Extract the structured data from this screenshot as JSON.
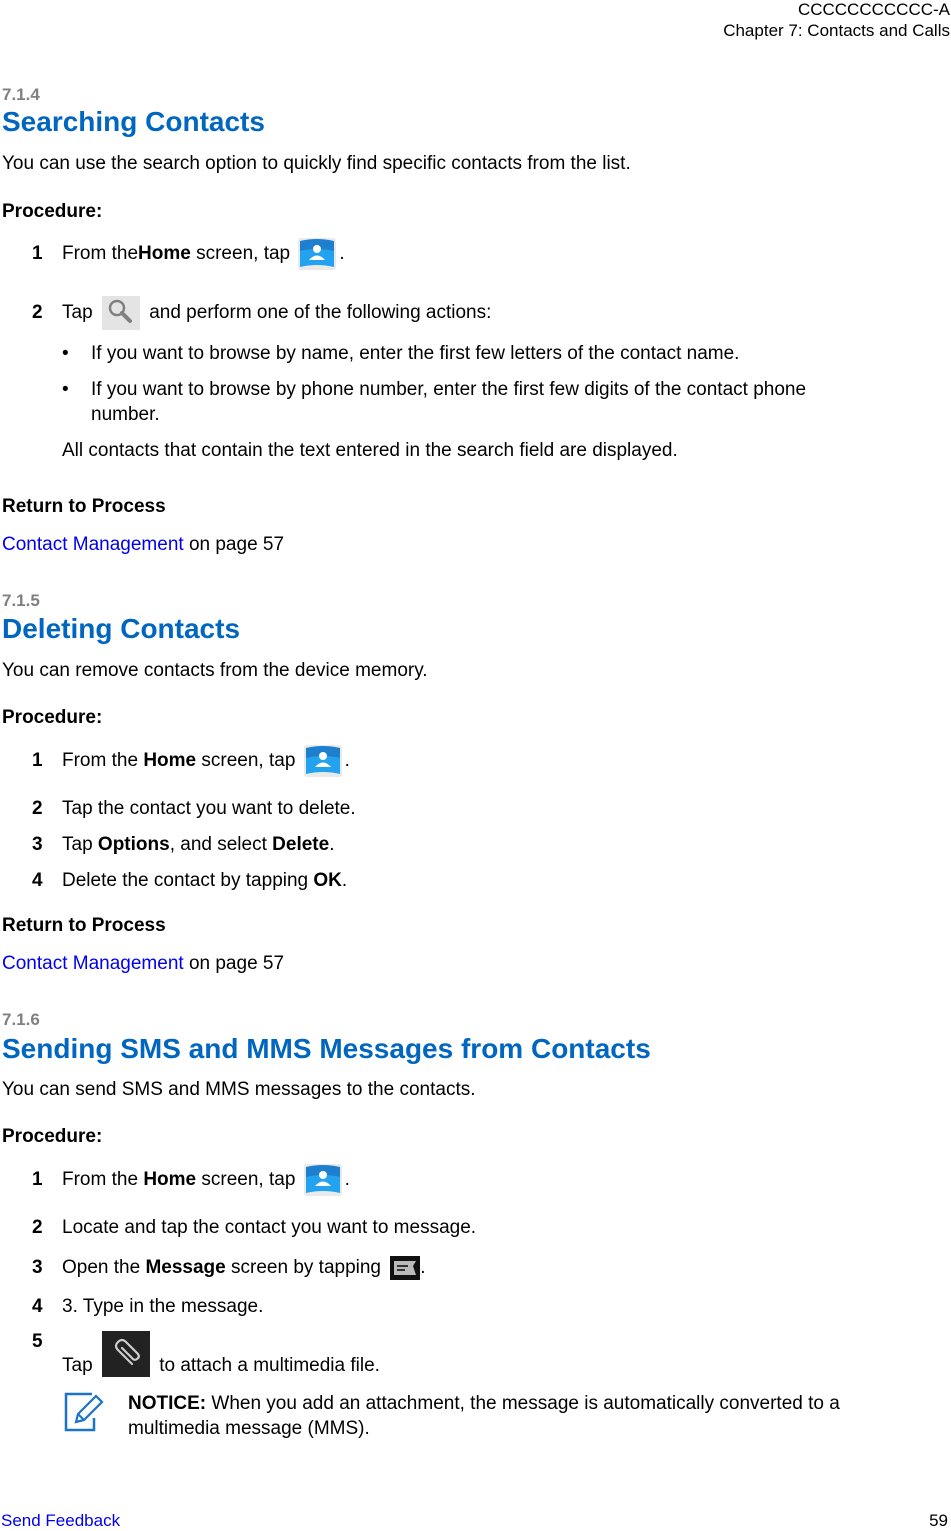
{
  "header": {
    "doc_id": "CCCCCCCCCCC-A",
    "chapter": "Chapter 7:  Contacts and Calls"
  },
  "sections": [
    {
      "number": "7.1.4",
      "title": "Searching Contacts",
      "intro": "You can use the search option to quickly find specific contacts from the list.",
      "procedure_label": "Procedure:",
      "steps": [
        {
          "num": "1",
          "pre": "From the ",
          "bold": "Home",
          "post": " screen, tap ",
          "icon": "contacts-app-icon",
          "end": "."
        },
        {
          "num": "2",
          "pre": "Tap ",
          "icon": "search-icon",
          "post": " and perform one of the following actions:"
        }
      ],
      "bullets": [
        "If you want to browse by name, enter the first few letters of the contact name.",
        "If you want to browse by phone number, enter the first few digits of the contact phone",
        "number."
      ],
      "result": "All contacts that contain the text entered in the search field are displayed.",
      "return_label": "Return to Process",
      "return_link": "Contact Management",
      "return_suffix": " on page 57"
    },
    {
      "number": "7.1.5",
      "title": "Deleting Contacts",
      "intro": "You can remove contacts from the device memory.",
      "procedure_label": "Procedure:",
      "steps": [
        {
          "num": "1",
          "pre": "From the ",
          "bold": "Home",
          "post": " screen, tap ",
          "icon": "contacts-app-icon",
          "end": "."
        },
        {
          "num": "2",
          "text": "Tap the contact you want to delete."
        },
        {
          "num": "3",
          "pre": "Tap ",
          "bold": "Options",
          "mid": ", and select ",
          "bold2": "Delete",
          "end": "."
        },
        {
          "num": "4",
          "pre": "Delete the contact by tapping ",
          "bold": "OK",
          "end": "."
        }
      ],
      "return_label": "Return to Process",
      "return_link": "Contact Management",
      "return_suffix": " on page 57"
    },
    {
      "number": "7.1.6",
      "title": "Sending SMS and MMS Messages from Contacts",
      "intro": "You can send SMS and MMS messages to the contacts.",
      "procedure_label": "Procedure:",
      "steps": [
        {
          "num": "1",
          "pre": "From the ",
          "bold": "Home",
          "post": " screen, tap ",
          "icon": "contacts-app-icon",
          "end": "."
        },
        {
          "num": "2",
          "text": "Locate and tap the contact you want to message."
        },
        {
          "num": "3",
          "pre": "Open the ",
          "bold": "Message",
          "post": " screen by tapping ",
          "icon": "message-icon",
          "end": "."
        },
        {
          "num": "4",
          "text": "3. Type in the message."
        },
        {
          "num": "5",
          "pre": "Tap ",
          "icon": "attachment-icon",
          "post": " to attach a multimedia file."
        }
      ],
      "notice": {
        "label": "NOTICE:",
        "line1": " When you add an attachment, the message is automatically converted to a",
        "line2": "multimedia message (MMS)."
      }
    }
  ],
  "footer": {
    "feedback": "Send Feedback",
    "page": "59"
  },
  "colors": {
    "heading": "#0066c0",
    "section_number": "#808080",
    "link": "#0000ee"
  }
}
